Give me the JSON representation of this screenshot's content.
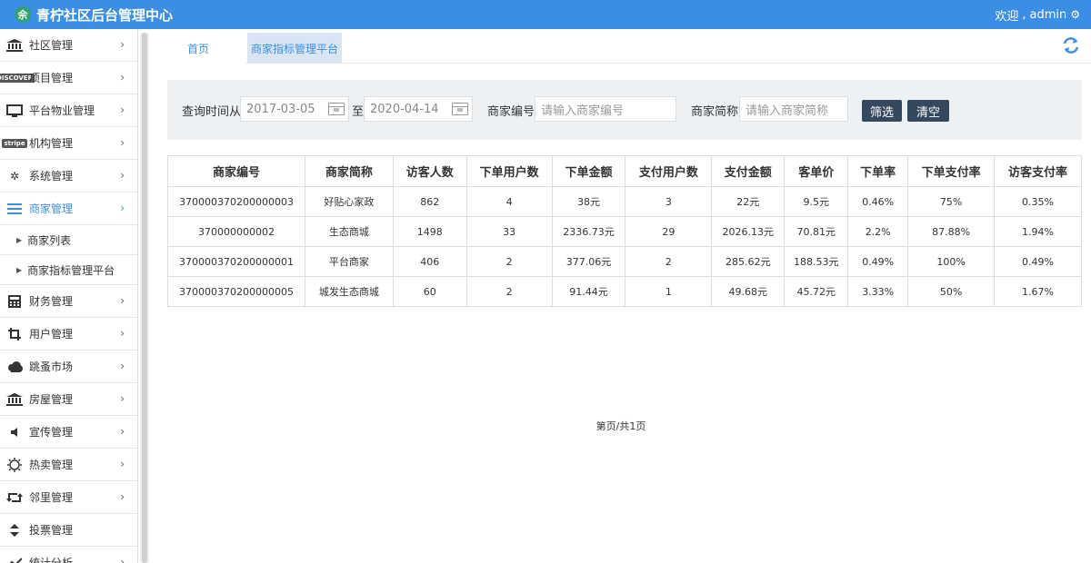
{
  "header": {
    "logo_char": "佘",
    "title": "青柠社区后台管理中心",
    "welcome_prefix": "欢迎",
    "separator": ",",
    "user": "admin",
    "settings_icon": "gear-icon"
  },
  "sidebar": {
    "items": [
      {
        "label": "社区管理",
        "icon": "bank-icon"
      },
      {
        "label": "项目管理",
        "icon": "discover-card-icon",
        "badge": "DISCOVER"
      },
      {
        "label": "平台物业管理",
        "icon": "monitor-icon"
      },
      {
        "label": "机构管理",
        "icon": "stripe-icon",
        "badge": "stripe"
      },
      {
        "label": "系统管理",
        "icon": "yelp-icon"
      },
      {
        "label": "商家管理",
        "icon": "list-icon",
        "active": true
      },
      {
        "label": "财务管理",
        "icon": "calculator-icon"
      },
      {
        "label": "用户管理",
        "icon": "crop-icon"
      },
      {
        "label": "跳蚤市场",
        "icon": "cloud-icon"
      },
      {
        "label": "房屋管理",
        "icon": "bank-icon"
      },
      {
        "label": "宣传管理",
        "icon": "volume-icon"
      },
      {
        "label": "热卖管理",
        "icon": "sun-icon"
      },
      {
        "label": "邻里管理",
        "icon": "retweet-icon"
      },
      {
        "label": "投票管理",
        "icon": "sort-icon"
      },
      {
        "label": "统计分析",
        "icon": "chart-icon"
      }
    ],
    "sub_items": [
      {
        "label": "商家列表"
      },
      {
        "label": "商家指标管理平台"
      }
    ]
  },
  "tabs": {
    "home": "首页",
    "current": "商家指标管理平台"
  },
  "filter": {
    "time_from_label": "查询时间从",
    "date_from": "2017-03-05",
    "to_label": "至",
    "date_to": "2020-04-14",
    "merchant_no_label": "商家编号:",
    "merchant_no_placeholder": "请输入商家编号",
    "merchant_short_label": "商家简称:",
    "merchant_short_placeholder": "请输入商家简称",
    "filter_button": "筛选",
    "clear_button": "清空"
  },
  "table": {
    "headers": [
      "商家编号",
      "商家简称",
      "访客人数",
      "下单用户数",
      "下单金额",
      "支付用户数",
      "支付金额",
      "客单价",
      "下单率",
      "下单支付率",
      "访客支付率"
    ],
    "rows": [
      [
        "370000370200000003",
        "好贴心家政",
        "862",
        "4",
        "38元",
        "3",
        "22元",
        "9.5元",
        "0.46%",
        "75%",
        "0.35%"
      ],
      [
        "370000000002",
        "生态商城",
        "1498",
        "33",
        "2336.73元",
        "29",
        "2026.13元",
        "70.81元",
        "2.2%",
        "87.88%",
        "1.94%"
      ],
      [
        "370000370200000001",
        "平台商家",
        "406",
        "2",
        "377.06元",
        "2",
        "285.62元",
        "188.53元",
        "0.49%",
        "100%",
        "0.49%"
      ],
      [
        "370000370200000005",
        "城发生态商城",
        "60",
        "2",
        "91.44元",
        "1",
        "49.68元",
        "45.72元",
        "3.33%",
        "50%",
        "1.67%"
      ]
    ]
  },
  "pager": {
    "text": "第页/共1页"
  },
  "colors": {
    "header_bg": "#3a8ee6",
    "active": "#3a8ee6",
    "button_bg": "#34495e"
  }
}
